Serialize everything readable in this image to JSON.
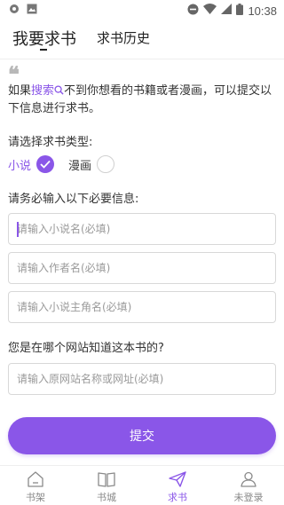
{
  "status_bar": {
    "time": "10:38",
    "icons": [
      "notification-dot-icon",
      "image-icon",
      "dnd-icon",
      "wifi-icon",
      "signal-icon",
      "battery-icon"
    ]
  },
  "tabs": [
    {
      "label": "我要求书",
      "active": true
    },
    {
      "label": "求书历史",
      "active": false
    }
  ],
  "intro": {
    "prefix": "如果",
    "search_label": "搜索",
    "suffix": "不到你想看的书籍或者漫画，可以提交以下信息进行求书。"
  },
  "type_section": {
    "label": "请选择求书类型:",
    "options": [
      {
        "label": "小说",
        "selected": true
      },
      {
        "label": "漫画",
        "selected": false
      }
    ]
  },
  "required_section": {
    "label": "请务必输入以下必要信息:",
    "fields": [
      {
        "placeholder": "请输入小说名(必填)",
        "value": ""
      },
      {
        "placeholder": "请输入作者名(必填)",
        "value": ""
      },
      {
        "placeholder": "请输入小说主角名(必填)",
        "value": ""
      }
    ]
  },
  "source_section": {
    "label": "您是在哪个网站知道这本书的?",
    "field": {
      "placeholder": "请输入原网站名称或网址(必填)",
      "value": ""
    }
  },
  "submit_label": "提交",
  "bottom_nav": [
    {
      "label": "书架",
      "icon": "home-icon",
      "active": false
    },
    {
      "label": "书城",
      "icon": "book-icon",
      "active": false
    },
    {
      "label": "求书",
      "icon": "send-icon",
      "active": true
    },
    {
      "label": "未登录",
      "icon": "user-icon",
      "active": false
    }
  ],
  "colors": {
    "accent": "#8a56e8",
    "text": "#333333",
    "muted": "#9a9a9a"
  }
}
